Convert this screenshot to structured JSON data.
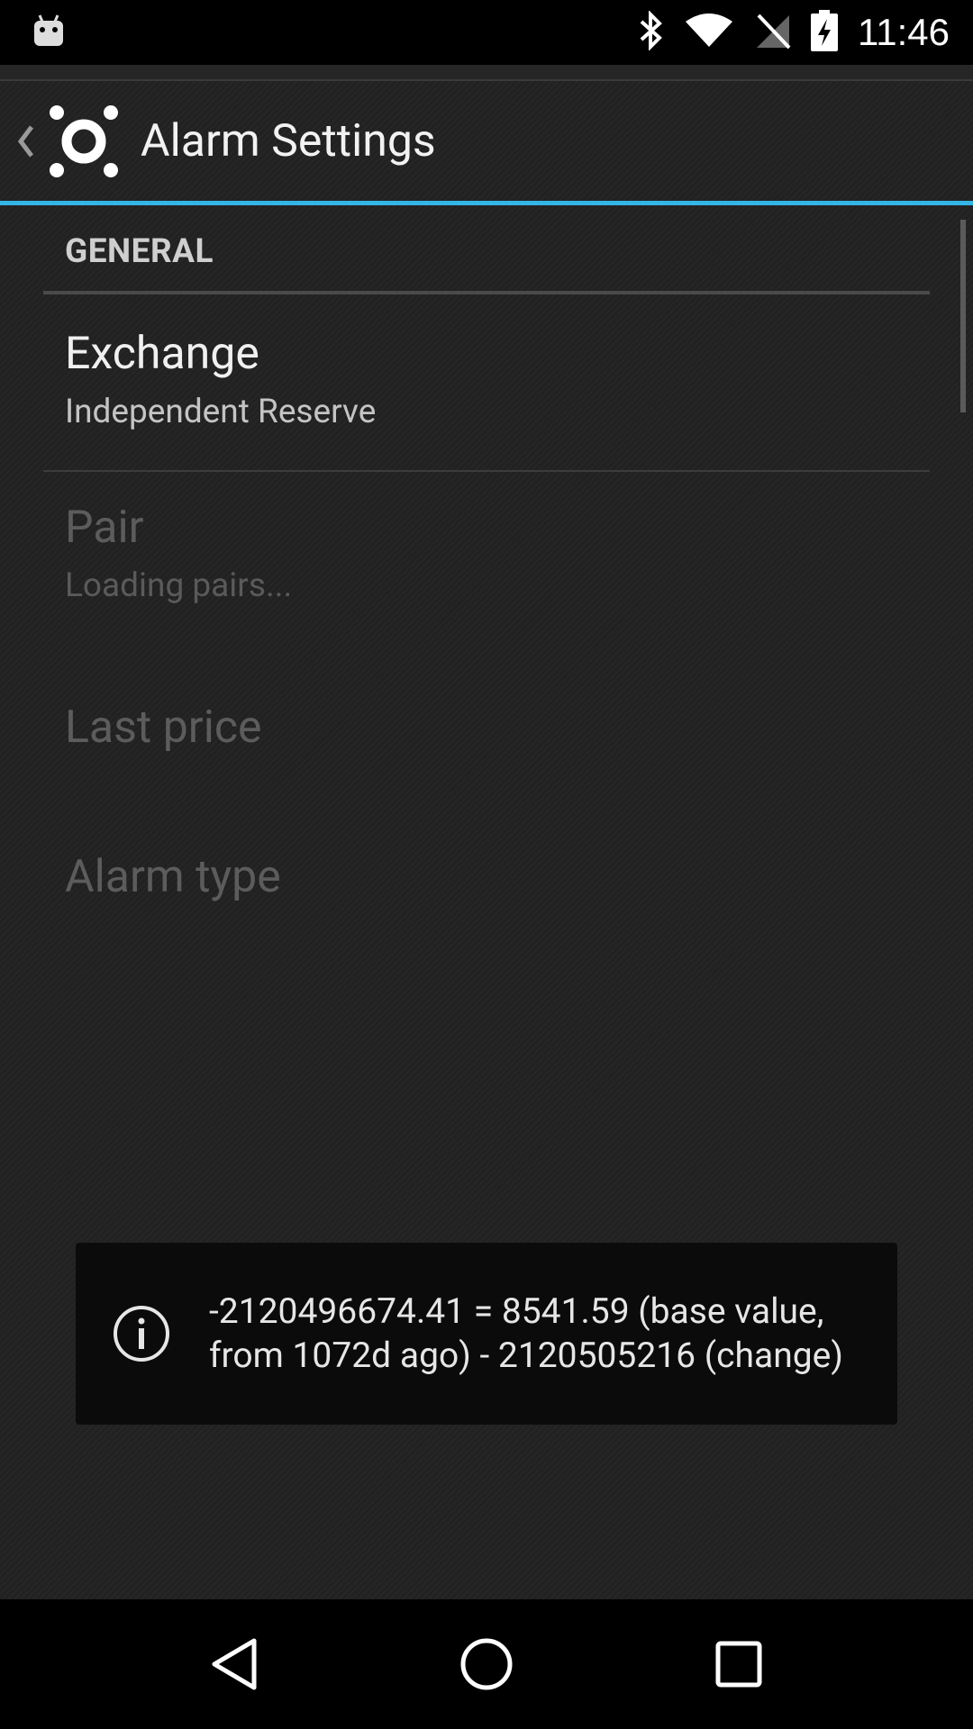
{
  "status_bar": {
    "time": "11:46",
    "icons": [
      "android-notification-icon",
      "bluetooth-icon",
      "wifi-icon",
      "no-sim-icon",
      "battery-charging-icon"
    ]
  },
  "action_bar": {
    "title": "Alarm Settings",
    "accent_color": "#33b5e5"
  },
  "section": {
    "header": "GENERAL"
  },
  "preferences": [
    {
      "title": "Exchange",
      "summary": "Independent Reserve",
      "enabled": true
    },
    {
      "title": "Pair",
      "summary": "Loading pairs...",
      "enabled": false
    },
    {
      "title": "Last price",
      "summary": "",
      "enabled": false
    },
    {
      "title": "Alarm type",
      "summary": "",
      "enabled": false
    }
  ],
  "toast": {
    "icon": "info-icon",
    "message": "-2120496674.41 = 8541.59 (base value, from 1072d ago) - 2120505216 (change)"
  },
  "nav_bar": {
    "buttons": [
      "back-icon",
      "home-icon",
      "recents-icon"
    ]
  }
}
